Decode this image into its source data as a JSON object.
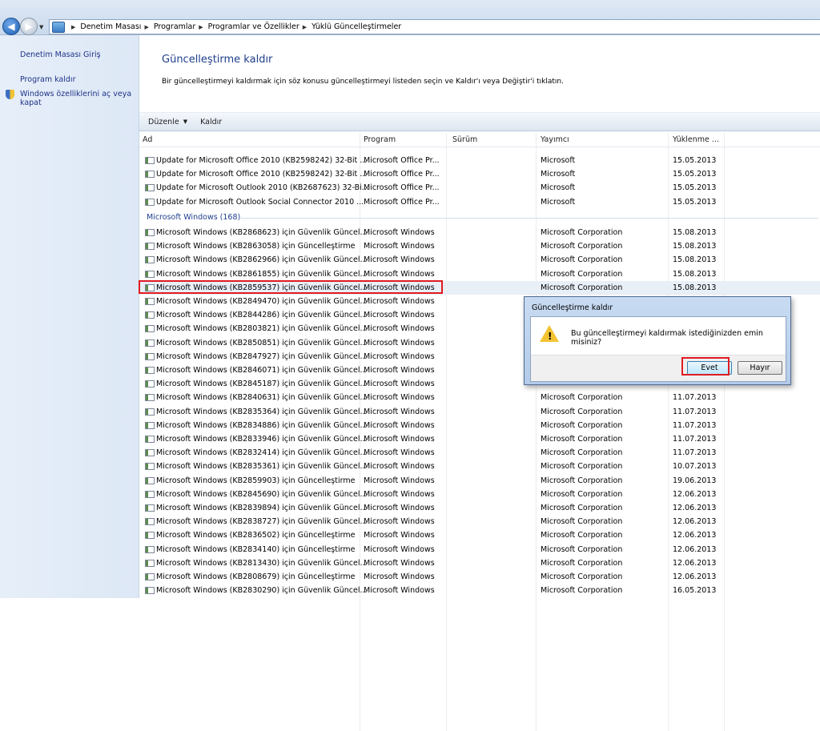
{
  "breadcrumb": [
    "Denetim Masası",
    "Programlar",
    "Programlar ve Özellikler",
    "Yüklü Güncelleştirmeler"
  ],
  "sidebar": {
    "home": "Denetim Masası Giriş",
    "uninstall_program": "Program kaldır",
    "windows_features_line1": "Windows özelliklerini aç veya",
    "windows_features_line2": "kapat"
  },
  "main": {
    "title": "Güncelleştirme kaldır",
    "description": "Bir güncelleştirmeyi kaldırmak için söz konusu güncelleştirmeyi listeden seçin ve Kaldır'ı veya Değiştir'i tıklatın."
  },
  "toolbar": {
    "organize": "Düzenle",
    "uninstall": "Kaldır"
  },
  "columns": {
    "name": "Ad",
    "program": "Program",
    "version": "Sürüm",
    "publisher": "Yayımcı",
    "installed": "Yüklenme ..."
  },
  "office_rows": [
    {
      "name": "Update for Microsoft Office 2010 (KB2598242) 32-Bit ...",
      "program": "Microsoft Office Pr...",
      "publisher": "Microsoft",
      "date": "15.05.2013"
    },
    {
      "name": "Update for Microsoft Office 2010 (KB2598242) 32-Bit ...",
      "program": "Microsoft Office Pr...",
      "publisher": "Microsoft",
      "date": "15.05.2013"
    },
    {
      "name": "Update for Microsoft Outlook 2010 (KB2687623) 32-Bi...",
      "program": "Microsoft Office Pr...",
      "publisher": "Microsoft",
      "date": "15.05.2013"
    },
    {
      "name": "Update for Microsoft Outlook Social Connector 2010 ...",
      "program": "Microsoft Office Pr...",
      "publisher": "Microsoft",
      "date": "15.05.2013"
    }
  ],
  "group_header": "Microsoft Windows (168)",
  "windows_rows": [
    {
      "name": "Microsoft Windows (KB2868623) için Güvenlik Güncel...",
      "program": "Microsoft Windows",
      "publisher": "Microsoft Corporation",
      "date": "15.08.2013"
    },
    {
      "name": "Microsoft Windows (KB2863058) için Güncelleştirme",
      "program": "Microsoft Windows",
      "publisher": "Microsoft Corporation",
      "date": "15.08.2013"
    },
    {
      "name": "Microsoft Windows (KB2862966) için Güvenlik Güncel...",
      "program": "Microsoft Windows",
      "publisher": "Microsoft Corporation",
      "date": "15.08.2013"
    },
    {
      "name": "Microsoft Windows (KB2861855) için Güvenlik Güncel...",
      "program": "Microsoft Windows",
      "publisher": "Microsoft Corporation",
      "date": "15.08.2013"
    },
    {
      "name": "Microsoft Windows (KB2859537) için Güvenlik Güncel...",
      "program": "Microsoft Windows",
      "publisher": "Microsoft Corporation",
      "date": "15.08.2013",
      "selected": true
    },
    {
      "name": "Microsoft Windows (KB2849470) için Güvenlik Güncel...",
      "program": "Microsoft Windows",
      "publisher": "",
      "date": ""
    },
    {
      "name": "Microsoft Windows (KB2844286) için Güvenlik Güncel...",
      "program": "Microsoft Windows",
      "publisher": "",
      "date": ""
    },
    {
      "name": "Microsoft Windows (KB2803821) için Güvenlik Güncel...",
      "program": "Microsoft Windows",
      "publisher": "",
      "date": ""
    },
    {
      "name": "Microsoft Windows (KB2850851) için Güvenlik Güncel...",
      "program": "Microsoft Windows",
      "publisher": "",
      "date": ""
    },
    {
      "name": "Microsoft Windows (KB2847927) için Güvenlik Güncel...",
      "program": "Microsoft Windows",
      "publisher": "",
      "date": ""
    },
    {
      "name": "Microsoft Windows (KB2846071) için Güvenlik Güncel...",
      "program": "Microsoft Windows",
      "publisher": "",
      "date": ""
    },
    {
      "name": "Microsoft Windows (KB2845187) için Güvenlik Güncel...",
      "program": "Microsoft Windows",
      "publisher": "",
      "date": ""
    },
    {
      "name": "Microsoft Windows (KB2840631) için Güvenlik Güncel...",
      "program": "Microsoft Windows",
      "publisher": "Microsoft Corporation",
      "date": "11.07.2013"
    },
    {
      "name": "Microsoft Windows (KB2835364) için Güvenlik Güncel...",
      "program": "Microsoft Windows",
      "publisher": "Microsoft Corporation",
      "date": "11.07.2013"
    },
    {
      "name": "Microsoft Windows (KB2834886) için Güvenlik Güncel...",
      "program": "Microsoft Windows",
      "publisher": "Microsoft Corporation",
      "date": "11.07.2013"
    },
    {
      "name": "Microsoft Windows (KB2833946) için Güvenlik Güncel...",
      "program": "Microsoft Windows",
      "publisher": "Microsoft Corporation",
      "date": "11.07.2013"
    },
    {
      "name": "Microsoft Windows (KB2832414) için Güvenlik Güncel...",
      "program": "Microsoft Windows",
      "publisher": "Microsoft Corporation",
      "date": "11.07.2013"
    },
    {
      "name": "Microsoft Windows (KB2835361) için Güvenlik Güncel...",
      "program": "Microsoft Windows",
      "publisher": "Microsoft Corporation",
      "date": "10.07.2013"
    },
    {
      "name": "Microsoft Windows (KB2859903) için Güncelleştirme",
      "program": "Microsoft Windows",
      "publisher": "Microsoft Corporation",
      "date": "19.06.2013"
    },
    {
      "name": "Microsoft Windows (KB2845690) için Güvenlik Güncel...",
      "program": "Microsoft Windows",
      "publisher": "Microsoft Corporation",
      "date": "12.06.2013"
    },
    {
      "name": "Microsoft Windows (KB2839894) için Güvenlik Güncel...",
      "program": "Microsoft Windows",
      "publisher": "Microsoft Corporation",
      "date": "12.06.2013"
    },
    {
      "name": "Microsoft Windows (KB2838727) için Güvenlik Güncel...",
      "program": "Microsoft Windows",
      "publisher": "Microsoft Corporation",
      "date": "12.06.2013"
    },
    {
      "name": "Microsoft Windows (KB2836502) için Güncelleştirme",
      "program": "Microsoft Windows",
      "publisher": "Microsoft Corporation",
      "date": "12.06.2013"
    },
    {
      "name": "Microsoft Windows (KB2834140) için Güncelleştirme",
      "program": "Microsoft Windows",
      "publisher": "Microsoft Corporation",
      "date": "12.06.2013"
    },
    {
      "name": "Microsoft Windows (KB2813430) için Güvenlik Güncel...",
      "program": "Microsoft Windows",
      "publisher": "Microsoft Corporation",
      "date": "12.06.2013"
    },
    {
      "name": "Microsoft Windows (KB2808679) için Güncelleştirme",
      "program": "Microsoft Windows",
      "publisher": "Microsoft Corporation",
      "date": "12.06.2013"
    },
    {
      "name": "Microsoft Windows (KB2830290) için Güvenlik Güncel...",
      "program": "Microsoft Windows",
      "publisher": "Microsoft Corporation",
      "date": "16.05.2013"
    }
  ],
  "dialog": {
    "title": "Güncelleştirme kaldır",
    "message": "Bu güncelleştirmeyi kaldırmak istediğinizden emin misiniz?",
    "yes": "Evet",
    "no": "Hayır"
  },
  "colors": {
    "link": "#1e3287",
    "title": "#1e3f8c",
    "highlight": "#e01b22"
  }
}
